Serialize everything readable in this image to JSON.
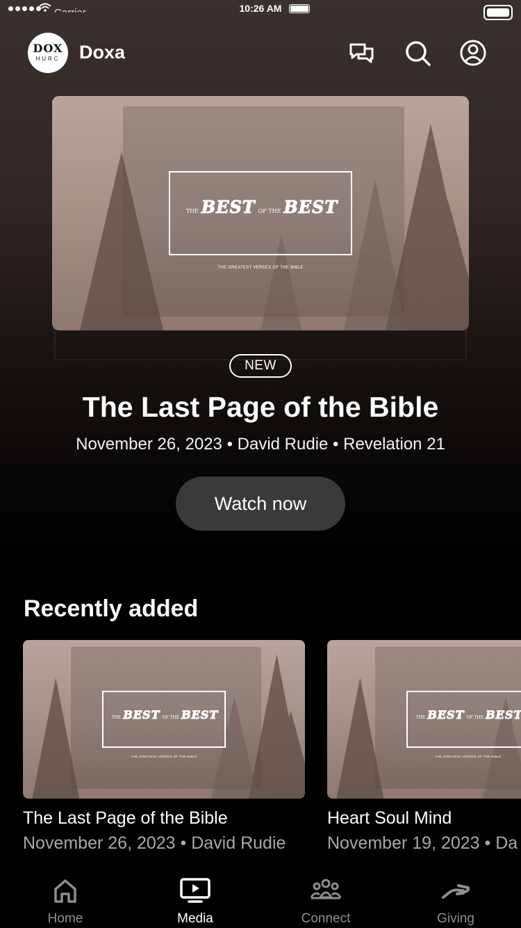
{
  "status_bar": {
    "carrier": "Carrier",
    "time": "10:26 AM"
  },
  "header": {
    "logo_line1": "DOX",
    "logo_line2": "HURC",
    "app_name": "Doxa",
    "icons": [
      "chat-icon",
      "search-icon",
      "profile-icon"
    ]
  },
  "hero": {
    "artwork": {
      "word_the": "THE",
      "word_best": "BEST",
      "word_of_the": "OF THE",
      "word_best2": "BEST",
      "subtitle": "THE GREATEST VERSES OF THE BIBLE"
    },
    "badge": "NEW",
    "title": "The Last Page of the Bible",
    "meta": "November 26, 2023 • David Rudie • Revelation 21",
    "button_label": "Watch now"
  },
  "recently_added": {
    "title": "Recently added",
    "items": [
      {
        "title": "The Last Page of the Bible",
        "meta": "November 26, 2023 • David Rudie"
      },
      {
        "title": "Heart Soul Mind",
        "meta": "November 19, 2023 • Da"
      }
    ]
  },
  "tabs": [
    {
      "label": "Home",
      "icon": "home-icon",
      "active": false
    },
    {
      "label": "Media",
      "icon": "media-icon",
      "active": true
    },
    {
      "label": "Connect",
      "icon": "people-icon",
      "active": false
    },
    {
      "label": "Giving",
      "icon": "giving-hand-icon",
      "active": false
    }
  ],
  "colors": {
    "background": "#000000",
    "button": "#3a3a3c",
    "inactive_tab": "#8e8e8e",
    "meta_text": "#a8a8a8"
  }
}
